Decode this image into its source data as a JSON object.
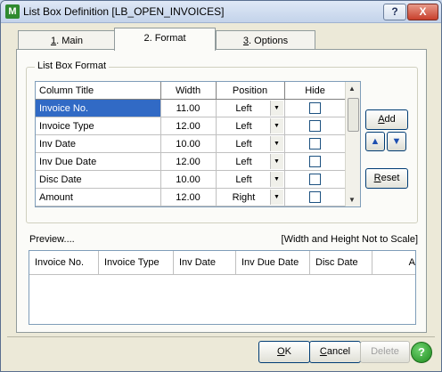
{
  "window": {
    "app_icon_letter": "M",
    "title": "List Box Definition  [LB_OPEN_INVOICES]",
    "help_button": "?",
    "close_button": "X"
  },
  "tabs": [
    {
      "label": "1. Main",
      "accel": "1",
      "rest": ". Main",
      "active": false
    },
    {
      "label": "2. Format",
      "accel": "2",
      "rest": ". Format",
      "active": true
    },
    {
      "label": "3. Options",
      "accel": "3",
      "rest": ". Options",
      "active": false
    }
  ],
  "format_group": {
    "label": "List Box Format",
    "columns": [
      "Column Title",
      "Width",
      "Position",
      "Hide"
    ],
    "rows": [
      {
        "title": "Invoice No.",
        "width": "11.00",
        "position": "Left",
        "hide": false,
        "selected": true
      },
      {
        "title": "Invoice Type",
        "width": "12.00",
        "position": "Left",
        "hide": false
      },
      {
        "title": "Inv Date",
        "width": "10.00",
        "position": "Left",
        "hide": false
      },
      {
        "title": "Inv Due Date",
        "width": "12.00",
        "position": "Left",
        "hide": false
      },
      {
        "title": "Disc Date",
        "width": "10.00",
        "position": "Left",
        "hide": false
      },
      {
        "title": "Amount",
        "width": "12.00",
        "position": "Right",
        "hide": false
      }
    ],
    "add_button": {
      "accel": "A",
      "rest": "dd"
    },
    "reset_button": {
      "accel": "R",
      "rest": "eset"
    }
  },
  "preview": {
    "label": "Preview....",
    "note": "[Width and Height Not to Scale]",
    "columns": [
      "Invoice No.",
      "Invoice Type",
      "Inv Date",
      "Inv Due Date",
      "Disc Date",
      "A"
    ]
  },
  "buttons": {
    "ok": {
      "accel": "O",
      "rest": "K"
    },
    "cancel": {
      "accel": "C",
      "rest": "ancel"
    },
    "delete": "Delete",
    "help": "?"
  },
  "colors": {
    "selection": "#316ac5",
    "arrow_blue": "#1d4fb0",
    "help_green": "#1d8a1d"
  }
}
